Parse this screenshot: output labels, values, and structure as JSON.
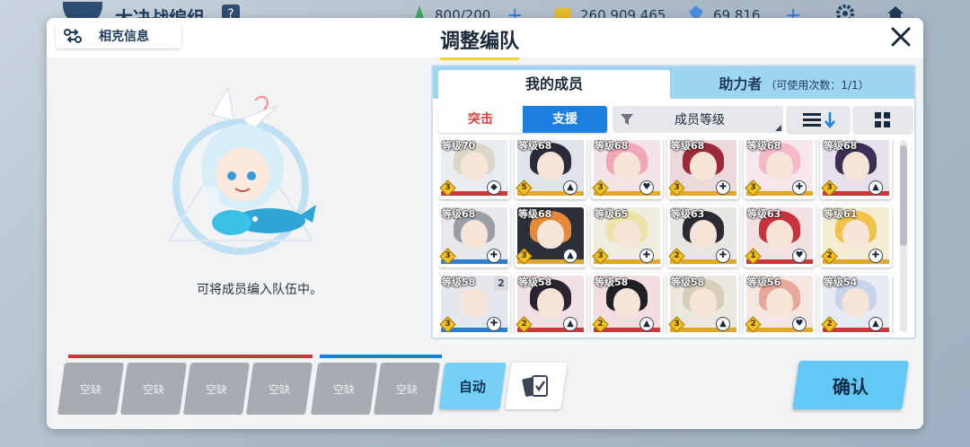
{
  "topbar": {
    "title": "大决战编组",
    "stamina": "800/200",
    "gold": "260,909,465",
    "gems": "69,816"
  },
  "modal": {
    "counter_label": "相克信息",
    "title": "调整编队",
    "empty_text": "可将成员编入队伍中。"
  },
  "tabs": {
    "mine": "我的成员",
    "helper": "助力者",
    "helper_count": "（可使用次数：1/1）"
  },
  "filters": {
    "attack": "突击",
    "support": "支援",
    "sort": "成员等级"
  },
  "cards": [
    {
      "level": "等级70",
      "rank": "3",
      "role": "◆",
      "hair": "#dcd6c8",
      "bg": "#e9edf2",
      "stripe": "#c63a3a"
    },
    {
      "level": "等级68",
      "rank": "5",
      "role": "▲",
      "hair": "#2a2b3a",
      "bg": "#dfe3ea",
      "stripe": "#e0a82e"
    },
    {
      "level": "等级68",
      "rank": "3",
      "role": "♥",
      "hair": "#f2a7b8",
      "bg": "#f4e4ea",
      "stripe": "#e0a82e"
    },
    {
      "level": "等级68",
      "rank": "3",
      "role": "✚",
      "hair": "#9c2a3a",
      "bg": "#ecd9dc",
      "stripe": "#e0a82e"
    },
    {
      "level": "等级68",
      "rank": "3",
      "role": "✚",
      "hair": "#f5b9c8",
      "bg": "#f6e7ec",
      "stripe": "#e0a82e"
    },
    {
      "level": "等级68",
      "rank": "3",
      "role": "▲",
      "hair": "#3c2f55",
      "bg": "#e5e0ec",
      "stripe": "#c63a3a"
    },
    {
      "level": "等级68",
      "rank": "3",
      "role": "✚",
      "hair": "#9a9ea6",
      "bg": "#e6e8ec",
      "stripe": "#2f7fd0"
    },
    {
      "level": "等级68",
      "rank": "3",
      "role": "▲",
      "hair": "#e58a3a",
      "bg": "#2a2f3a",
      "stripe": "#e0a82e"
    },
    {
      "level": "等级65",
      "rank": "3",
      "role": "✚",
      "hair": "#efe2a8",
      "bg": "#efece0",
      "stripe": "#e0a82e"
    },
    {
      "level": "等级63",
      "rank": "2",
      "role": "✚",
      "hair": "#2a2b32",
      "bg": "#e8e6e2",
      "stripe": "#e0a82e"
    },
    {
      "level": "等级63",
      "rank": "1",
      "role": "♥",
      "hair": "#c8343e",
      "bg": "#f3e2e2",
      "stripe": "#c63a3a"
    },
    {
      "level": "等级61",
      "rank": "2",
      "role": "✚",
      "hair": "#f0c34a",
      "bg": "#f5ecd4",
      "stripe": "#e0a82e"
    },
    {
      "level": "等级58",
      "rank": "3",
      "role": "✚",
      "hair": "#e6e6ea",
      "bg": "#e4e8ee",
      "stripe": "#2f7fd0",
      "dup": "2"
    },
    {
      "level": "等级58",
      "rank": "2",
      "role": "▲",
      "hair": "#2a2430",
      "bg": "#f0e0e4",
      "stripe": "#c63a3a"
    },
    {
      "level": "等级58",
      "rank": "2",
      "role": "▲",
      "hair": "#1f1f26",
      "bg": "#f2dede",
      "stripe": "#c63a3a"
    },
    {
      "level": "等级58",
      "rank": "3",
      "role": "▲",
      "hair": "#d8cfb8",
      "bg": "#ebe8e0",
      "stripe": "#e0a82e"
    },
    {
      "level": "等级56",
      "rank": "2",
      "role": "♥",
      "hair": "#e8a89a",
      "bg": "#f4e6e2",
      "stripe": "#e0a82e"
    },
    {
      "level": "等级54",
      "rank": "2",
      "role": "▲",
      "hair": "#c9d4ea",
      "bg": "#e6eaf3",
      "stripe": "#c63a3a"
    }
  ],
  "slots": {
    "empty_label": "空缺",
    "count": 6
  },
  "buttons": {
    "auto": "自动",
    "confirm": "确认"
  },
  "colors": {
    "accent_blue": "#1a7fe0",
    "attack_red": "#c63a3a",
    "confirm_cyan": "#63c8f5",
    "title_underline": "#f4d22b"
  }
}
